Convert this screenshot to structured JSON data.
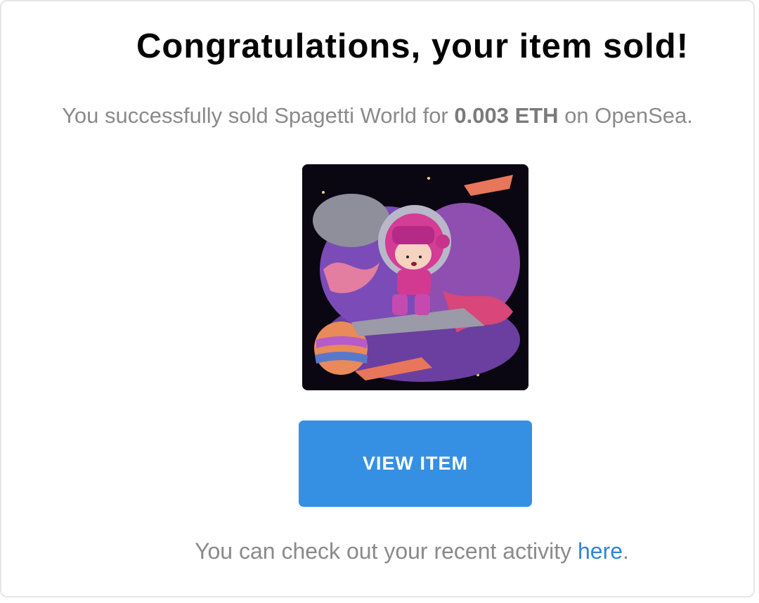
{
  "email": {
    "title": "Congratulations, your item sold!",
    "subtitle_prefix": "You successfully sold Spagetti World for ",
    "price": "0.003 ETH",
    "subtitle_suffix": " on OpenSea.",
    "image_icon": "nft-artwork-icon",
    "button_label": "VIEW ITEM",
    "footer_prefix": "You can check out your recent activity ",
    "footer_link": "here",
    "footer_suffix": ".",
    "colors": {
      "button": "#3590e4",
      "link": "#2f86d6",
      "muted_text": "#8a8a8a",
      "image_bg": "#0a0612"
    }
  }
}
